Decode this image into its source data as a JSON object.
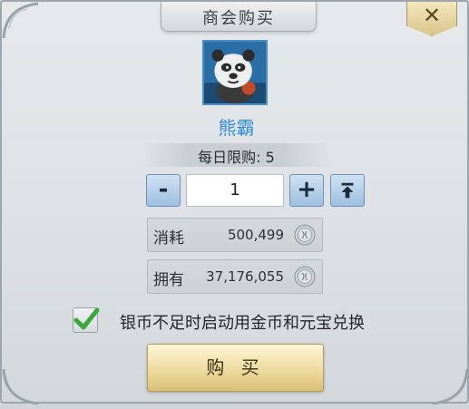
{
  "dialog": {
    "title": "商会购买",
    "close_label": "✕"
  },
  "item": {
    "name": "熊霸",
    "portrait_icon": "panda-warrior-portrait"
  },
  "limit": {
    "label": "每日限购: 5"
  },
  "quantity": {
    "decrease_label": "-",
    "value": "1",
    "increase_label": "+",
    "max_label": "⤒"
  },
  "cost": {
    "label": "消耗",
    "value": "500,499",
    "icon": "silver-coin-icon"
  },
  "owned": {
    "label": "拥有",
    "value": "37,176,055",
    "icon": "silver-coin-icon"
  },
  "auto_exchange": {
    "checked": true,
    "label": "银币不足时启动用金币和元宝兑换"
  },
  "buy_button": {
    "label": "购 买"
  },
  "colors": {
    "name": "#2f8be0",
    "accent_gold": "#ecd89a",
    "check_green": "#3aa83a"
  }
}
